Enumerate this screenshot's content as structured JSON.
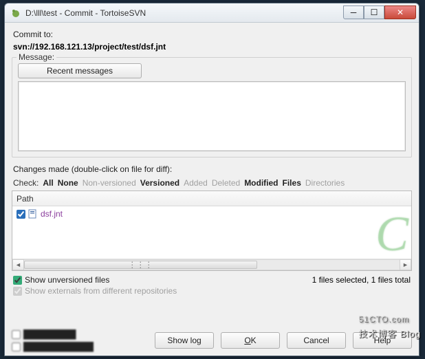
{
  "window": {
    "title": "D:\\lll\\test - Commit - TortoiseSVN"
  },
  "commit": {
    "to_label": "Commit to:",
    "url": "svn://192.168.121.13/project/test/dsf.jnt"
  },
  "message": {
    "legend": "Message:",
    "recent_button": "Recent messages",
    "text": ""
  },
  "changes": {
    "label": "Changes made (double-click on file for diff):",
    "check_label": "Check:",
    "filters": {
      "all": "All",
      "none": "None",
      "nonversioned": "Non-versioned",
      "versioned": "Versioned",
      "added": "Added",
      "deleted": "Deleted",
      "modified": "Modified",
      "files": "Files",
      "directories": "Directories"
    },
    "columns": {
      "path": "Path"
    },
    "files": [
      {
        "checked": true,
        "name": "dsf.jnt"
      }
    ],
    "status": "1 files selected, 1 files total"
  },
  "options": {
    "show_unversioned": {
      "label": "Show unversioned files",
      "checked": true
    },
    "show_externals": {
      "label": "Show externals from different repositories",
      "checked": true,
      "disabled": true
    }
  },
  "footer": {
    "show_log": "Show log",
    "ok": "OK",
    "cancel": "Cancel",
    "help": "Help"
  },
  "branding": {
    "main": "51CTO.com",
    "sub": "技术博客 Blog"
  }
}
